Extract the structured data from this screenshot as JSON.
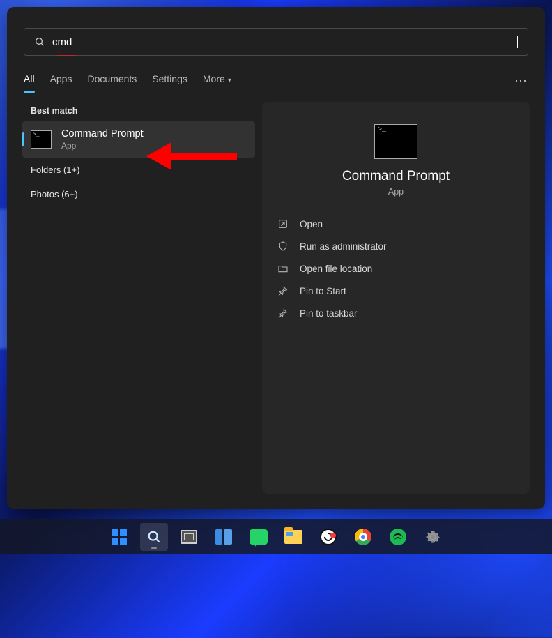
{
  "search": {
    "query": "cmd"
  },
  "tabs": {
    "items": [
      "All",
      "Apps",
      "Documents",
      "Settings",
      "More"
    ],
    "active": 0
  },
  "left": {
    "best_label": "Best match",
    "result": {
      "title": "Command Prompt",
      "subtitle": "App"
    },
    "categories": [
      {
        "label": "Folders (1+)"
      },
      {
        "label": "Photos (6+)"
      }
    ]
  },
  "preview": {
    "title": "Command Prompt",
    "subtitle": "App",
    "actions": [
      {
        "icon": "open",
        "label": "Open"
      },
      {
        "icon": "shield",
        "label": "Run as administrator"
      },
      {
        "icon": "folder",
        "label": "Open file location"
      },
      {
        "icon": "pin",
        "label": "Pin to Start"
      },
      {
        "icon": "pin",
        "label": "Pin to taskbar"
      }
    ]
  }
}
